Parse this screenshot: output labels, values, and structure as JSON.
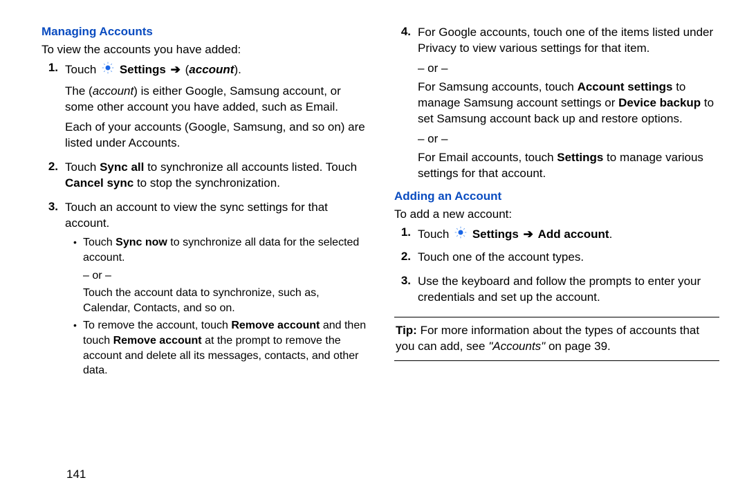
{
  "page_number": "141",
  "left": {
    "heading": "Managing Accounts",
    "intro": "To view the accounts you have added:",
    "step1_prefix": "Touch ",
    "step1_settings": "Settings",
    "step1_arrow": "➔",
    "step1_account_open": "(",
    "step1_account": "account",
    "step1_account_close": ").",
    "step1_para_a1": "The (",
    "step1_para_a_account": "account",
    "step1_para_a2": ") is either Google, Samsung account, or some other account you have added, such as Email.",
    "step1_para_b": "Each of your accounts (Google, Samsung, and so on) are listed under Accounts.",
    "step2_prefix": "Touch ",
    "step2_syncall": "Sync all",
    "step2_mid": " to synchronize all accounts listed. Touch ",
    "step2_cancel": "Cancel sync",
    "step2_suffix": " to stop the synchronization.",
    "step3": "Touch an account to view the sync settings for that account.",
    "bullet1_prefix": "Touch ",
    "bullet1_syncnow": "Sync now",
    "bullet1_suffix": " to synchronize all data for the selected account.",
    "bullet_or": "– or –",
    "bullet1_alt": "Touch the account data to synchronize, such as, Calendar, Contacts, and so on.",
    "bullet2_prefix": "To remove the account, touch ",
    "bullet2_remove": "Remove account",
    "bullet2_mid": " and then touch ",
    "bullet2_remove2": "Remove account",
    "bullet2_suffix": " at the prompt to remove the account and delete all its messages, contacts, and other data."
  },
  "right": {
    "step4_a": "For Google accounts, touch one of the items listed under Privacy to view various settings for that item.",
    "or": "– or –",
    "step4_b_prefix": "For Samsung accounts, touch ",
    "step4_b_acctset": "Account settings",
    "step4_b_mid": " to manage Samsung account settings or ",
    "step4_b_backup": "Device backup",
    "step4_b_suffix": " to set Samsung account back up and restore options.",
    "step4_c_prefix": "For Email accounts, touch ",
    "step4_c_settings": "Settings",
    "step4_c_suffix": " to manage various settings for that account.",
    "heading2": "Adding an Account",
    "intro2": "To add a new account:",
    "add_step1_prefix": "Touch ",
    "add_step1_settings": "Settings",
    "add_step1_arrow": "➔",
    "add_step1_addacct": "Add account",
    "add_step1_suffix": ".",
    "add_step2": "Touch one of the account types.",
    "add_step3": "Use the keyboard and follow the prompts to enter your credentials and set up the account.",
    "tip_label": "Tip:",
    "tip_text_a": " For more information about the types of accounts that you can add, see ",
    "tip_accounts": "\"Accounts\"",
    "tip_text_b": " on page 39."
  },
  "numbers": {
    "n1": "1.",
    "n2": "2.",
    "n3": "3.",
    "n4": "4."
  }
}
